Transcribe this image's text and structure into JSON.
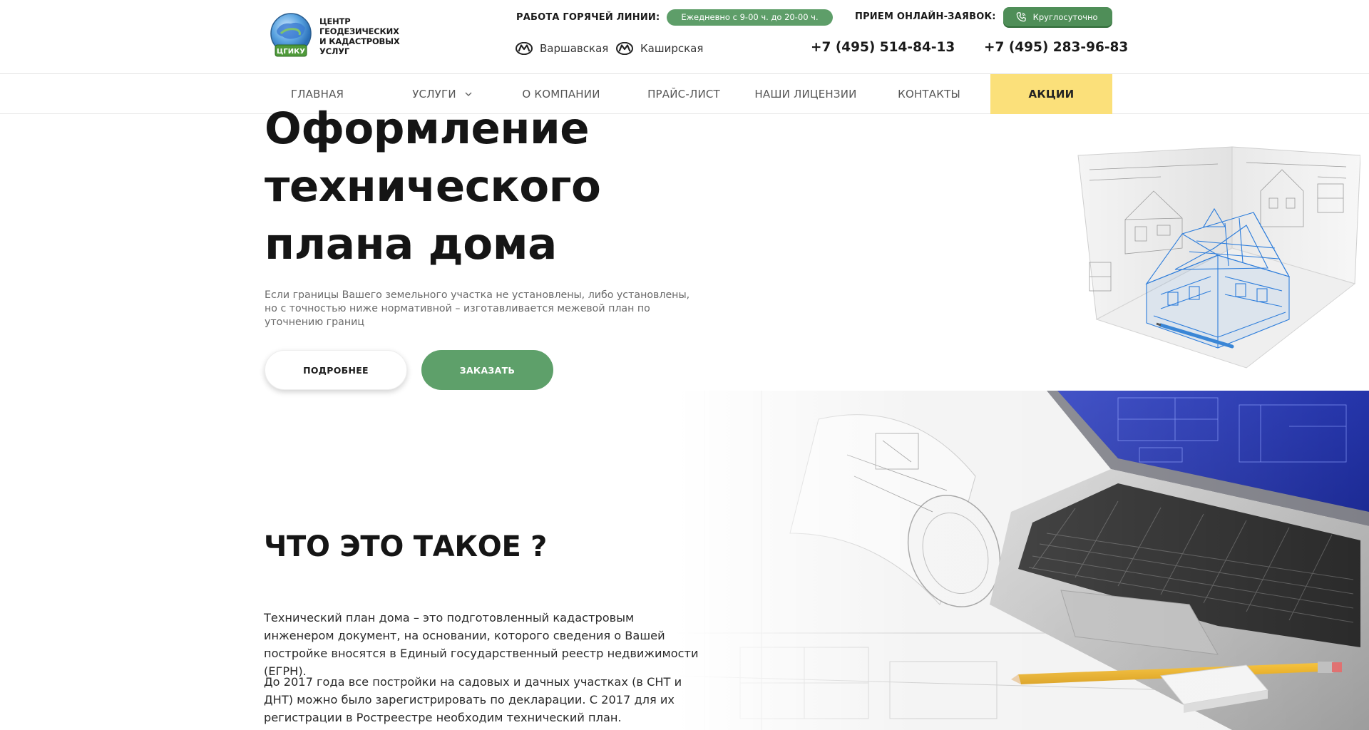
{
  "header": {
    "logo_text_line1": "ЦЕНТР ГЕОДЕЗИЧЕСКИХ",
    "logo_text_line2": "И КАДАСТРОВЫХ УСЛУГ",
    "logo_badge": "ЦГИКУ",
    "hotline_label": "РАБОТА ГОРЯЧЕЙ ЛИНИИ:",
    "hotline_hours": "Ежедневно с 9-00 ч. до 20-00 ч.",
    "online_label": "ПРИЕМ ОНЛАЙН-ЗАЯВОК:",
    "online_hours": "Круглосуточно",
    "metro": [
      {
        "name": "Варшавская"
      },
      {
        "name": "Каширская"
      }
    ],
    "phones": [
      "+7 (495) 514-84-13",
      "+7 (495) 283-96-83"
    ]
  },
  "nav": {
    "items": [
      {
        "label": "ГЛАВНАЯ"
      },
      {
        "label": "УСЛУГИ"
      },
      {
        "label": "О КОМПАНИИ"
      },
      {
        "label": "ПРАЙС-ЛИСТ"
      },
      {
        "label": "НАШИ ЛИЦЕНЗИИ"
      },
      {
        "label": "КОНТАКТЫ"
      },
      {
        "label": "АКЦИИ"
      }
    ]
  },
  "hero": {
    "title_line1": "Оформление",
    "title_line2": "технического",
    "title_line3": "плана дома",
    "subtitle": "Если границы Вашего земельного участка не установлены, либо установлены, но с точностью ниже нормативной – изготавливается межевой план по уточнению границ",
    "btn_more": "ПОДРОБНЕЕ",
    "btn_order": "ЗАКАЗАТЬ"
  },
  "section": {
    "title": "ЧТО ЭТО ТАКОЕ ?",
    "p1": "Технический план дома – это подготовленный кадастровым инженером документ, на основании, которого сведения о Вашей постройке вносятся в Единый государственный реестр недвижимости (ЕГРН).",
    "p2": "До 2017 года все постройки на садовых и дачных участках (в СНТ и ДНТ) можно было зарегистрировать по декларации. С 2017 для их регистрации в Ростреестре необходим технический план."
  },
  "colors": {
    "accent_green": "#5ea06a",
    "promo_yellow": "#fbe07a"
  }
}
